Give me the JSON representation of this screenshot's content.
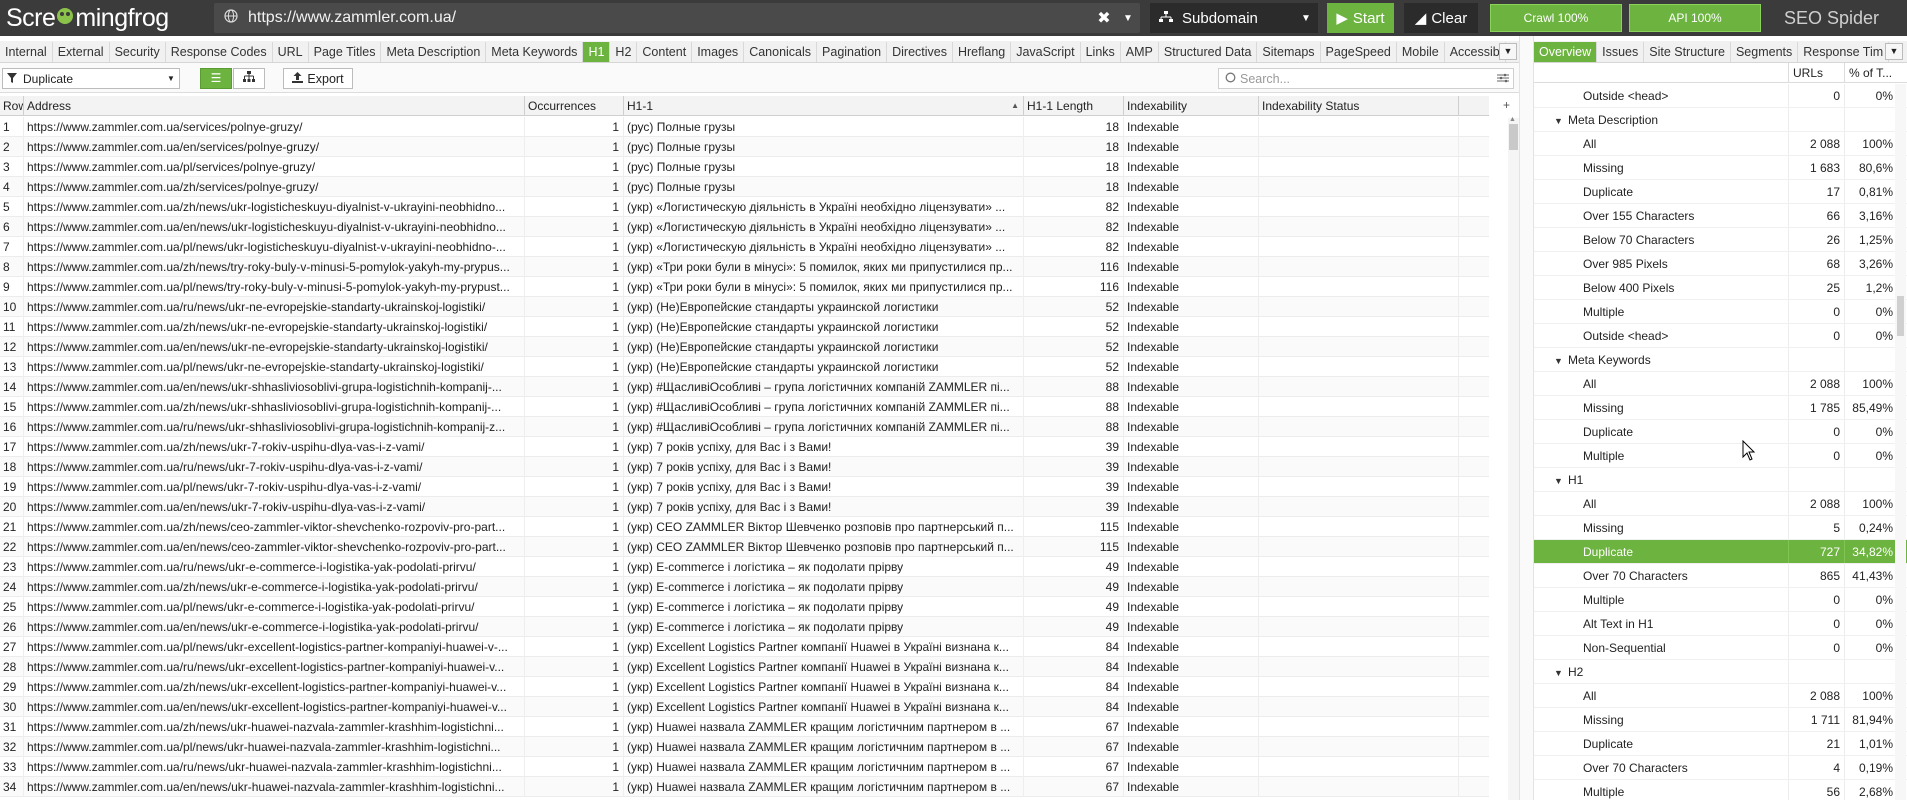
{
  "app": {
    "logo_prefix": "Scre",
    "logo_frog": "•",
    "logo_suffix": "mingfrog",
    "product": "SEO Spider"
  },
  "topbar": {
    "url": "https://www.zammler.com.ua/",
    "mode": "Subdomain",
    "start_label": "Start",
    "clear_label": "Clear",
    "crawl_progress": "Crawl 100%",
    "api_progress": "API 100%"
  },
  "tabs": [
    "Internal",
    "External",
    "Security",
    "Response Codes",
    "URL",
    "Page Titles",
    "Meta Description",
    "Meta Keywords",
    "H1",
    "H2",
    "Content",
    "Images",
    "Canonicals",
    "Pagination",
    "Directives",
    "Hreflang",
    "JavaScript",
    "Links",
    "AMP",
    "Structured Data",
    "Sitemaps",
    "PageSpeed",
    "Mobile",
    "Accessib"
  ],
  "active_tab": "H1",
  "toolbar": {
    "filter": "Duplicate",
    "export_label": "Export",
    "search_placeholder": "Search..."
  },
  "table": {
    "columns": [
      "Row",
      "Address",
      "Occurrences",
      "H1-1",
      "H1-1 Length",
      "Indexability",
      "Indexability Status"
    ],
    "rows": [
      [
        "1",
        "https://www.zammler.com.ua/services/polnye-gruzy/",
        "1",
        "(рус) Полные грузы",
        "18",
        "Indexable",
        ""
      ],
      [
        "2",
        "https://www.zammler.com.ua/en/services/polnye-gruzy/",
        "1",
        "(рус) Полные грузы",
        "18",
        "Indexable",
        ""
      ],
      [
        "3",
        "https://www.zammler.com.ua/pl/services/polnye-gruzy/",
        "1",
        "(рус) Полные грузы",
        "18",
        "Indexable",
        ""
      ],
      [
        "4",
        "https://www.zammler.com.ua/zh/services/polnye-gruzy/",
        "1",
        "(рус) Полные грузы",
        "18",
        "Indexable",
        ""
      ],
      [
        "5",
        "https://www.zammler.com.ua/zh/news/ukr-logisticheskuyu-diyalnist-v-ukrayini-neobhidno...",
        "1",
        "(укр) «Логистическую діяльність в Україні необхідно ліцензувати» ...",
        "82",
        "Indexable",
        ""
      ],
      [
        "6",
        "https://www.zammler.com.ua/en/news/ukr-logisticheskuyu-diyalnist-v-ukrayini-neobhidno...",
        "1",
        "(укр) «Логистическую діяльність в Україні необхідно ліцензувати» ...",
        "82",
        "Indexable",
        ""
      ],
      [
        "7",
        "https://www.zammler.com.ua/pl/news/ukr-logisticheskuyu-diyalnist-v-ukrayini-neobhidno-...",
        "1",
        "(укр) «Логистическую діяльність в Україні необхідно ліцензувати» ...",
        "82",
        "Indexable",
        ""
      ],
      [
        "8",
        "https://www.zammler.com.ua/zh/news/try-roky-buly-v-minusi-5-pomylok-yakyh-my-prypus...",
        "1",
        "(укр) «Три роки були в мінусі»: 5 помилок, яких ми припустилися пр...",
        "116",
        "Indexable",
        ""
      ],
      [
        "9",
        "https://www.zammler.com.ua/pl/news/try-roky-buly-v-minusi-5-pomylok-yakyh-my-prypust...",
        "1",
        "(укр) «Три роки були в мінусі»: 5 помилок, яких ми припустилися пр...",
        "116",
        "Indexable",
        ""
      ],
      [
        "10",
        "https://www.zammler.com.ua/ru/news/ukr-ne-evropejskie-standarty-ukrainskoj-logistiki/",
        "1",
        "(укр) (Не)Европейские стандарты украинской логистики",
        "52",
        "Indexable",
        ""
      ],
      [
        "11",
        "https://www.zammler.com.ua/zh/news/ukr-ne-evropejskie-standarty-ukrainskoj-logistiki/",
        "1",
        "(укр) (Не)Европейские стандарты украинской логистики",
        "52",
        "Indexable",
        ""
      ],
      [
        "12",
        "https://www.zammler.com.ua/en/news/ukr-ne-evropejskie-standarty-ukrainskoj-logistiki/",
        "1",
        "(укр) (Не)Европейские стандарты украинской логистики",
        "52",
        "Indexable",
        ""
      ],
      [
        "13",
        "https://www.zammler.com.ua/pl/news/ukr-ne-evropejskie-standarty-ukrainskoj-logistiki/",
        "1",
        "(укр) (Не)Европейские стандарты украинской логистики",
        "52",
        "Indexable",
        ""
      ],
      [
        "14",
        "https://www.zammler.com.ua/en/news/ukr-shhasliviosoblivi-grupa-logistichnih-kompanij-...",
        "1",
        "(укр) #ЩасливіОсобливі – група логістичних компаній ZAMMLER пі...",
        "88",
        "Indexable",
        ""
      ],
      [
        "15",
        "https://www.zammler.com.ua/zh/news/ukr-shhasliviosoblivi-grupa-logistichnih-kompanij-...",
        "1",
        "(укр) #ЩасливіОсобливі – група логістичних компаній ZAMMLER пі...",
        "88",
        "Indexable",
        ""
      ],
      [
        "16",
        "https://www.zammler.com.ua/ru/news/ukr-shhasliviosoblivi-grupa-logistichnih-kompanij-z...",
        "1",
        "(укр) #ЩасливіОсобливі – група логістичних компаній ZAMMLER пі...",
        "88",
        "Indexable",
        ""
      ],
      [
        "17",
        "https://www.zammler.com.ua/zh/news/ukr-7-rokiv-uspihu-dlya-vas-i-z-vami/",
        "1",
        "(укр) 7 років успіху, для Вас і з Вами!",
        "39",
        "Indexable",
        ""
      ],
      [
        "18",
        "https://www.zammler.com.ua/ru/news/ukr-7-rokiv-uspihu-dlya-vas-i-z-vami/",
        "1",
        "(укр) 7 років успіху, для Вас і з Вами!",
        "39",
        "Indexable",
        ""
      ],
      [
        "19",
        "https://www.zammler.com.ua/pl/news/ukr-7-rokiv-uspihu-dlya-vas-i-z-vami/",
        "1",
        "(укр) 7 років успіху, для Вас і з Вами!",
        "39",
        "Indexable",
        ""
      ],
      [
        "20",
        "https://www.zammler.com.ua/en/news/ukr-7-rokiv-uspihu-dlya-vas-i-z-vami/",
        "1",
        "(укр) 7 років успіху, для Вас і з Вами!",
        "39",
        "Indexable",
        ""
      ],
      [
        "21",
        "https://www.zammler.com.ua/zh/news/ceo-zammler-viktor-shevchenko-rozpoviv-pro-part...",
        "1",
        "(укр) CEO ZAMMLER Віктор Шевченко розповів про партнерський п...",
        "115",
        "Indexable",
        ""
      ],
      [
        "22",
        "https://www.zammler.com.ua/en/news/ceo-zammler-viktor-shevchenko-rozpoviv-pro-part...",
        "1",
        "(укр) CEO ZAMMLER Віктор Шевченко розповів про партнерський п...",
        "115",
        "Indexable",
        ""
      ],
      [
        "23",
        "https://www.zammler.com.ua/ru/news/ukr-e-commerce-i-logistika-yak-podolati-prirvu/",
        "1",
        "(укр) E-commerce і логістика – як подолати прірву",
        "49",
        "Indexable",
        ""
      ],
      [
        "24",
        "https://www.zammler.com.ua/zh/news/ukr-e-commerce-i-logistika-yak-podolati-prirvu/",
        "1",
        "(укр) E-commerce і логістика – як подолати прірву",
        "49",
        "Indexable",
        ""
      ],
      [
        "25",
        "https://www.zammler.com.ua/pl/news/ukr-e-commerce-i-logistika-yak-podolati-prirvu/",
        "1",
        "(укр) E-commerce і логістика – як подолати прірву",
        "49",
        "Indexable",
        ""
      ],
      [
        "26",
        "https://www.zammler.com.ua/en/news/ukr-e-commerce-i-logistika-yak-podolati-prirvu/",
        "1",
        "(укр) E-commerce і логістика – як подолати прірву",
        "49",
        "Indexable",
        ""
      ],
      [
        "27",
        "https://www.zammler.com.ua/pl/news/ukr-excellent-logistics-partner-kompaniyi-huawei-v-...",
        "1",
        "(укр) Excellent Logistics Partner компанії Huawei в Україні визнана к...",
        "84",
        "Indexable",
        ""
      ],
      [
        "28",
        "https://www.zammler.com.ua/ru/news/ukr-excellent-logistics-partner-kompaniyi-huawei-v...",
        "1",
        "(укр) Excellent Logistics Partner компанії Huawei в Україні визнана к...",
        "84",
        "Indexable",
        ""
      ],
      [
        "29",
        "https://www.zammler.com.ua/zh/news/ukr-excellent-logistics-partner-kompaniyi-huawei-v...",
        "1",
        "(укр) Excellent Logistics Partner компанії Huawei в Україні визнана к...",
        "84",
        "Indexable",
        ""
      ],
      [
        "30",
        "https://www.zammler.com.ua/en/news/ukr-excellent-logistics-partner-kompaniyi-huawei-v...",
        "1",
        "(укр) Excellent Logistics Partner компанії Huawei в Україні визнана к...",
        "84",
        "Indexable",
        ""
      ],
      [
        "31",
        "https://www.zammler.com.ua/zh/news/ukr-huawei-nazvala-zammler-krashhim-logistichni...",
        "1",
        "(укр) Huawei назвала ZAMMLER кращим логістичним партнером в ...",
        "67",
        "Indexable",
        ""
      ],
      [
        "32",
        "https://www.zammler.com.ua/pl/news/ukr-huawei-nazvala-zammler-krashhim-logistichni...",
        "1",
        "(укр) Huawei назвала ZAMMLER кращим логістичним партнером в ...",
        "67",
        "Indexable",
        ""
      ],
      [
        "33",
        "https://www.zammler.com.ua/ru/news/ukr-huawei-nazvala-zammler-krashhim-logistichni...",
        "1",
        "(укр) Huawei назвала ZAMMLER кращим логістичним партнером в ...",
        "67",
        "Indexable",
        ""
      ],
      [
        "34",
        "https://www.zammler.com.ua/en/news/ukr-huawei-nazvala-zammler-krashhim-logistichni...",
        "1",
        "(укр) Huawei назвала ZAMMLER кращим логістичним партнером в ...",
        "67",
        "Indexable",
        ""
      ]
    ]
  },
  "right_panel": {
    "tabs": [
      "Overview",
      "Issues",
      "Site Structure",
      "Segments",
      "Response Tim"
    ],
    "active_tab": "Overview",
    "col_urls": "URLs",
    "col_pct": "% of T...",
    "rows": [
      {
        "type": "item",
        "name": "Outside <head>",
        "urls": "0",
        "pct": "0%"
      },
      {
        "type": "group",
        "name": "Meta Description"
      },
      {
        "type": "item",
        "name": "All",
        "urls": "2 088",
        "pct": "100%"
      },
      {
        "type": "item",
        "name": "Missing",
        "urls": "1 683",
        "pct": "80,6%"
      },
      {
        "type": "item",
        "name": "Duplicate",
        "urls": "17",
        "pct": "0,81%"
      },
      {
        "type": "item",
        "name": "Over 155 Characters",
        "urls": "66",
        "pct": "3,16%"
      },
      {
        "type": "item",
        "name": "Below 70 Characters",
        "urls": "26",
        "pct": "1,25%"
      },
      {
        "type": "item",
        "name": "Over 985 Pixels",
        "urls": "68",
        "pct": "3,26%"
      },
      {
        "type": "item",
        "name": "Below 400 Pixels",
        "urls": "25",
        "pct": "1,2%"
      },
      {
        "type": "item",
        "name": "Multiple",
        "urls": "0",
        "pct": "0%"
      },
      {
        "type": "item",
        "name": "Outside <head>",
        "urls": "0",
        "pct": "0%"
      },
      {
        "type": "group",
        "name": "Meta Keywords"
      },
      {
        "type": "item",
        "name": "All",
        "urls": "2 088",
        "pct": "100%"
      },
      {
        "type": "item",
        "name": "Missing",
        "urls": "1 785",
        "pct": "85,49%"
      },
      {
        "type": "item",
        "name": "Duplicate",
        "urls": "0",
        "pct": "0%"
      },
      {
        "type": "item",
        "name": "Multiple",
        "urls": "0",
        "pct": "0%"
      },
      {
        "type": "group",
        "name": "H1"
      },
      {
        "type": "item",
        "name": "All",
        "urls": "2 088",
        "pct": "100%"
      },
      {
        "type": "item",
        "name": "Missing",
        "urls": "5",
        "pct": "0,24%"
      },
      {
        "type": "item",
        "name": "Duplicate",
        "urls": "727",
        "pct": "34,82%",
        "selected": true
      },
      {
        "type": "item",
        "name": "Over 70 Characters",
        "urls": "865",
        "pct": "41,43%"
      },
      {
        "type": "item",
        "name": "Multiple",
        "urls": "0",
        "pct": "0%"
      },
      {
        "type": "item",
        "name": "Alt Text in H1",
        "urls": "0",
        "pct": "0%"
      },
      {
        "type": "item",
        "name": "Non-Sequential",
        "urls": "0",
        "pct": "0%"
      },
      {
        "type": "group",
        "name": "H2"
      },
      {
        "type": "item",
        "name": "All",
        "urls": "2 088",
        "pct": "100%"
      },
      {
        "type": "item",
        "name": "Missing",
        "urls": "1 711",
        "pct": "81,94%"
      },
      {
        "type": "item",
        "name": "Duplicate",
        "urls": "21",
        "pct": "1,01%"
      },
      {
        "type": "item",
        "name": "Over 70 Characters",
        "urls": "4",
        "pct": "0,19%"
      },
      {
        "type": "item",
        "name": "Multiple",
        "urls": "56",
        "pct": "2,68%"
      }
    ]
  },
  "colors": {
    "accent": "#6cb33f",
    "topbar": "#3b3b3b"
  }
}
